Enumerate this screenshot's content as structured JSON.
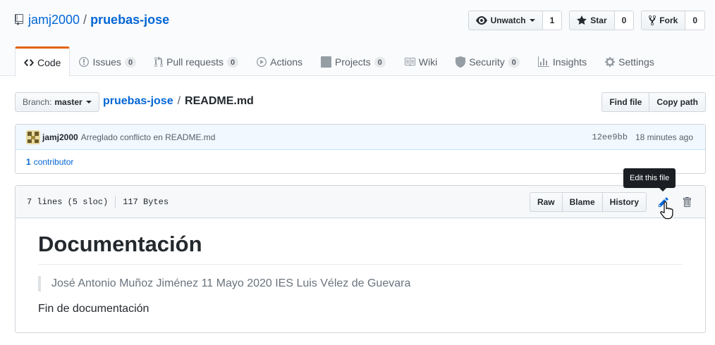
{
  "repo": {
    "owner": "jamj2000",
    "name": "pruebas-jose"
  },
  "actions": {
    "watch": {
      "label": "Unwatch",
      "count": "1"
    },
    "star": {
      "label": "Star",
      "count": "0"
    },
    "fork": {
      "label": "Fork",
      "count": "0"
    }
  },
  "nav": {
    "code": {
      "label": "Code"
    },
    "issues": {
      "label": "Issues",
      "count": "0"
    },
    "pulls": {
      "label": "Pull requests",
      "count": "0"
    },
    "actions": {
      "label": "Actions"
    },
    "projects": {
      "label": "Projects",
      "count": "0"
    },
    "wiki": {
      "label": "Wiki"
    },
    "security": {
      "label": "Security",
      "count": "0"
    },
    "insights": {
      "label": "Insights"
    },
    "settings": {
      "label": "Settings"
    }
  },
  "file_nav": {
    "branch_label": "Branch:",
    "branch": "master",
    "breadcrumb_root": "pruebas-jose",
    "breadcrumb_sep": "/",
    "file_name": "README.md",
    "find_file": "Find file",
    "copy_path": "Copy path"
  },
  "commit": {
    "author": "jamj2000",
    "message": "Arreglado conflicto en README.md",
    "sha": "12ee9bb",
    "time": "18 minutes ago",
    "contributors_count": "1",
    "contributors_label": "contributor"
  },
  "file": {
    "lines": "7 lines (5 sloc)",
    "size": "117 Bytes",
    "raw": "Raw",
    "blame": "Blame",
    "history": "History",
    "edit_tooltip": "Edit this file"
  },
  "readme": {
    "heading": "Documentación",
    "quote": "José Antonio Muñoz Jiménez 11 Mayo 2020 IES Luis Vélez de Guevara",
    "paragraph": "Fin de documentación"
  },
  "colors": {
    "link": "#0366d6",
    "nav_selected_border": "#e36209",
    "commit_bg": "#f1f8ff"
  }
}
